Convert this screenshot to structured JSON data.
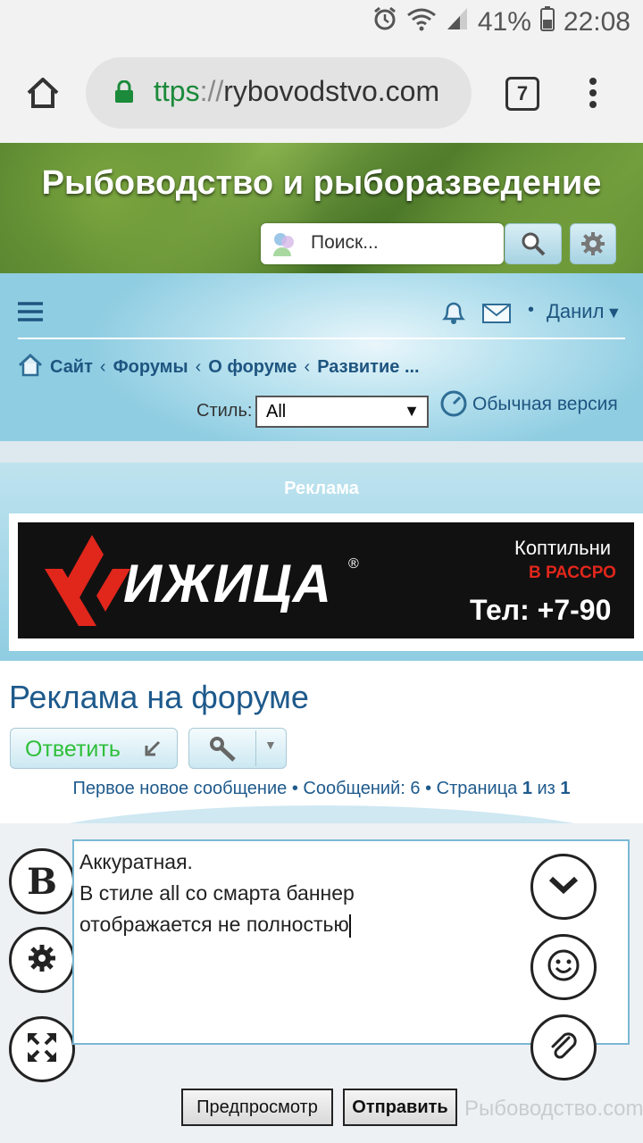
{
  "status": {
    "battery": "41%",
    "time": "22:08"
  },
  "browser": {
    "scheme": "ttps",
    "sep": "://",
    "host": "rybovodstvo.com",
    "tab_count": "7"
  },
  "header": {
    "site_title": "Рыбоводство и рыборазведение",
    "search_placeholder": "Поиск..."
  },
  "nav": {
    "user": "Данил",
    "breadcrumbs": [
      "Сайт",
      "Форумы",
      "О форуме",
      "Развитие ..."
    ],
    "style_label": "Стиль:",
    "style_value": "All",
    "mobile_link": "Обычная версия"
  },
  "ad": {
    "heading": "Реклама",
    "brand": "ИЖИЦА",
    "text1": "Коптильни",
    "text2": "В РАССРО",
    "text3": "Тел: +7-90"
  },
  "thread": {
    "title": "Реклама на форуме",
    "reply_label": "Ответить",
    "meta_prefix": "Первое новое сообщение • Сообщений: 6 • Страница ",
    "page_current": "1",
    "meta_of": " из ",
    "page_total": "1"
  },
  "editor": {
    "lines": [
      "Аккуратная.",
      "В стиле all со смарта баннер",
      "отображается не полностью"
    ],
    "preview_label": "Предпросмотр",
    "send_label": "Отправить",
    "watermark": "Рыбоводство.com"
  },
  "colors": {
    "link": "#1e5a8c",
    "reply_green": "#2fbf3a",
    "ad_red": "#e1261c"
  }
}
